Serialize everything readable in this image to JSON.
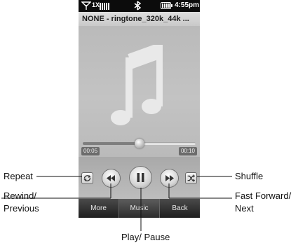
{
  "status_bar": {
    "network": "1X",
    "time": "4:55pm",
    "icons": [
      "signal-icon",
      "signal-bars-icon",
      "bluetooth-icon",
      "battery-icon"
    ]
  },
  "track": {
    "title": "NONE - ringtone_320k_44k ..."
  },
  "playback": {
    "elapsed": "00:05",
    "total": "00:10",
    "progress": 0.5
  },
  "controls": {
    "repeat_icon": "repeat-icon",
    "rewind_icon": "rewind-icon",
    "play_pause_icon": "pause-icon",
    "fast_forward_icon": "fast-forward-icon",
    "shuffle_icon": "shuffle-icon"
  },
  "softkeys": [
    {
      "label": "More"
    },
    {
      "label": "Music"
    },
    {
      "label": "Back"
    }
  ],
  "callouts": {
    "repeat": "Repeat",
    "rewind_line1": "Rewind/",
    "rewind_line2": "Previous",
    "play_pause": "Play/ Pause",
    "shuffle": "Shuffle",
    "ffwd_line1": "Fast Forward/",
    "ffwd_line2": "Next"
  },
  "colors": {
    "status_bar_bg": "#0c0c0c",
    "screen_bg": "#bdbdbd",
    "softkey_bg": "#2c2c2c"
  }
}
